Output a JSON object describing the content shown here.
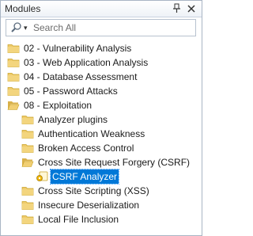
{
  "panel": {
    "title": "Modules",
    "pin_icon": "pin-icon",
    "close_icon": "close-icon"
  },
  "search": {
    "placeholder": "Search All",
    "value": "",
    "icon": "search-icon"
  },
  "tree": {
    "items": [
      {
        "label": "02 - Vulnerability Analysis",
        "level": 0,
        "icon": "folder-icon",
        "expanded": false,
        "selected": false
      },
      {
        "label": "03 - Web Application Analysis",
        "level": 0,
        "icon": "folder-icon",
        "expanded": false,
        "selected": false
      },
      {
        "label": "04 - Database Assessment",
        "level": 0,
        "icon": "folder-icon",
        "expanded": false,
        "selected": false
      },
      {
        "label": "05 - Password Attacks",
        "level": 0,
        "icon": "folder-icon",
        "expanded": false,
        "selected": false
      },
      {
        "label": "08 - Exploitation",
        "level": 0,
        "icon": "folder-open-icon",
        "expanded": true,
        "selected": false
      },
      {
        "label": "Analyzer plugins",
        "level": 1,
        "icon": "folder-icon",
        "expanded": false,
        "selected": false
      },
      {
        "label": "Authentication Weakness",
        "level": 1,
        "icon": "folder-icon",
        "expanded": false,
        "selected": false
      },
      {
        "label": "Broken Access Control",
        "level": 1,
        "icon": "folder-icon",
        "expanded": false,
        "selected": false
      },
      {
        "label": "Cross Site Request Forgery (CSRF)",
        "level": 1,
        "icon": "folder-open-icon",
        "expanded": true,
        "selected": false
      },
      {
        "label": "CSRF Analyzer",
        "level": 2,
        "icon": "module-icon",
        "expanded": false,
        "selected": true
      },
      {
        "label": "Cross Site Scripting (XSS)",
        "level": 1,
        "icon": "folder-icon",
        "expanded": false,
        "selected": false
      },
      {
        "label": "Insecure Deserialization",
        "level": 1,
        "icon": "folder-icon",
        "expanded": false,
        "selected": false
      },
      {
        "label": "Local File Inclusion",
        "level": 1,
        "icon": "folder-icon",
        "expanded": false,
        "selected": false
      }
    ]
  },
  "colors": {
    "selection": "#0078d7",
    "folder": "#e9c46a",
    "folder_dark": "#c9a227"
  }
}
